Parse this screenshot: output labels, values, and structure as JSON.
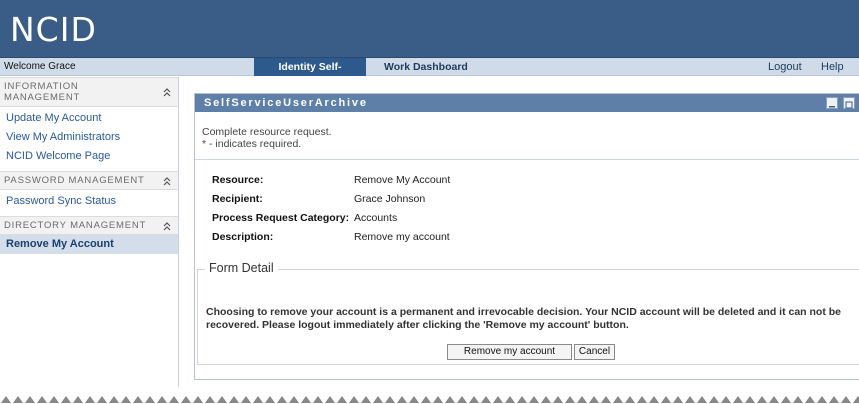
{
  "app": {
    "logo": "NCID"
  },
  "nav": {
    "welcome": "Welcome Grace",
    "tabs": [
      {
        "label": "Identity Self-Service",
        "active": true
      },
      {
        "label": "Work Dashboard",
        "active": false
      }
    ],
    "logout": "Logout",
    "help": "Help"
  },
  "sidebar": {
    "sections": [
      {
        "title": "INFORMATION MANAGEMENT",
        "items": [
          "Update My Account",
          "View My Administrators",
          "NCID Welcome Page"
        ]
      },
      {
        "title": "PASSWORD MANAGEMENT",
        "items": [
          "Password Sync Status"
        ]
      },
      {
        "title": "DIRECTORY MANAGEMENT",
        "items": [
          "Remove My Account"
        ],
        "active_item": "Remove My Account"
      }
    ]
  },
  "portlet": {
    "title": "SelfServiceUserArchive",
    "intro_line1": "Complete resource request.",
    "intro_line2": "* - indicates required.",
    "fields": [
      {
        "label": "Resource:",
        "value": "Remove My Account"
      },
      {
        "label": "Recipient:",
        "value": "Grace Johnson"
      },
      {
        "label": "Process Request Category:",
        "value": "Accounts"
      },
      {
        "label": "Description:",
        "value": "Remove my account"
      }
    ],
    "form_detail": {
      "legend": "Form Detail",
      "message": "Choosing to remove your account is a permanent and irrevocable decision. Your NCID account will be deleted and it can not be recovered. Please logout immediately after clicking the 'Remove my account' button.",
      "remove_button": "Remove my account",
      "cancel_button": "Cancel"
    }
  },
  "colors": {
    "header_bg": "#3a5d87",
    "nav_bg": "#cfdbe8",
    "active_tab": "#2d5a8c",
    "portlet_title_bg": "#5d7fa8",
    "link": "#2a5a9a"
  },
  "icons": {
    "collapse": "chevron-double-up-icon",
    "minimize": "minimize-icon",
    "maximize": "maximize-icon"
  }
}
